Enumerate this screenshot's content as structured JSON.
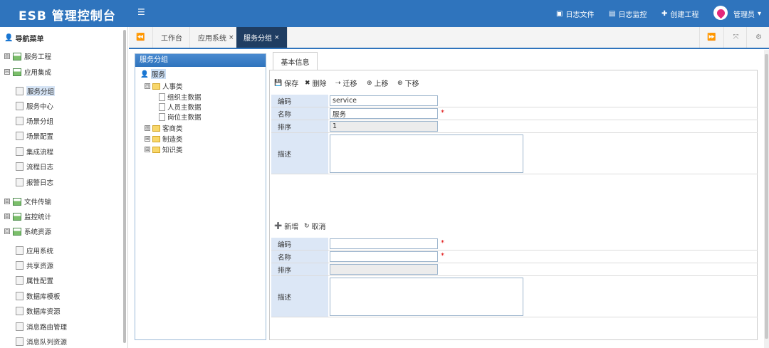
{
  "app": {
    "title": "ESB 管理控制台"
  },
  "header": {
    "menu_icon": "menu-icon",
    "links": [
      {
        "label": "日志文件",
        "icon": "file-icon"
      },
      {
        "label": "日志监控",
        "icon": "monitor-icon"
      },
      {
        "label": "创建工程",
        "icon": "plus-icon"
      }
    ],
    "user": "管理员"
  },
  "sidebar": {
    "title": "导航菜单",
    "items": [
      {
        "label": "服务工程",
        "toggle": "⊞",
        "type": "group"
      },
      {
        "label": "应用集成",
        "toggle": "⊟",
        "type": "group"
      },
      {
        "label": "服务分组",
        "type": "leaf",
        "active": true
      },
      {
        "label": "服务中心",
        "type": "leaf"
      },
      {
        "label": "场景分组",
        "type": "leaf"
      },
      {
        "label": "场景配置",
        "type": "leaf"
      },
      {
        "label": "集成流程",
        "type": "leaf"
      },
      {
        "label": "流程日志",
        "type": "leaf"
      },
      {
        "label": "报警日志",
        "type": "leaf"
      },
      {
        "label": "文件传输",
        "toggle": "⊞",
        "type": "group"
      },
      {
        "label": "监控统计",
        "toggle": "⊞",
        "type": "group"
      },
      {
        "label": "系统资源",
        "toggle": "⊟",
        "type": "group"
      },
      {
        "label": "应用系统",
        "type": "leaf"
      },
      {
        "label": "共享资源",
        "type": "leaf"
      },
      {
        "label": "属性配置",
        "type": "leaf"
      },
      {
        "label": "数据库模板",
        "type": "leaf"
      },
      {
        "label": "数据库资源",
        "type": "leaf"
      },
      {
        "label": "消息路由管理",
        "type": "leaf"
      },
      {
        "label": "消息队列资源",
        "type": "leaf"
      }
    ]
  },
  "tabs": [
    {
      "label": "工作台"
    },
    {
      "label": "应用系统",
      "close": "×"
    },
    {
      "label": "服务分组",
      "close": "×",
      "active": true
    }
  ],
  "tree_panel": {
    "title": "服务分组",
    "root": "服务",
    "nodes": [
      {
        "label": "人事类",
        "toggle": "⊟"
      },
      {
        "label": "组织主数据"
      },
      {
        "label": "人员主数据"
      },
      {
        "label": "岗位主数据"
      },
      {
        "label": "客商类",
        "toggle": "⊞"
      },
      {
        "label": "制造类",
        "toggle": "⊞"
      },
      {
        "label": "知识类",
        "toggle": "⊞"
      }
    ]
  },
  "detail": {
    "tab": "基本信息",
    "toolbar": [
      "保存",
      "删除",
      "迁移",
      "上移",
      "下移"
    ],
    "form": {
      "code_label": "编码",
      "code_value": "service",
      "name_label": "名称",
      "name_value": "服务",
      "order_label": "排序",
      "order_value": "1",
      "desc_label": "描述",
      "required_mark": "*"
    },
    "toolbar2": [
      "新增",
      "取消"
    ],
    "form2": {
      "code_label": "编码",
      "code_value": "",
      "name_label": "名称",
      "name_value": "",
      "order_label": "排序",
      "order_value": "",
      "desc_label": "描述",
      "required_mark": "*"
    }
  }
}
